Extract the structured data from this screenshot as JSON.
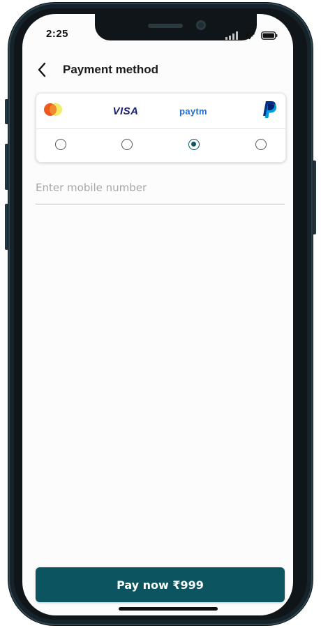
{
  "status_bar": {
    "time": "2:25"
  },
  "header": {
    "title": "Payment method",
    "back_icon": "chevron-left-icon"
  },
  "payment_methods": [
    {
      "name": "mastercard",
      "icon": "mastercard-logo-icon",
      "selected": false
    },
    {
      "name": "visa",
      "label": "VISA",
      "selected": false
    },
    {
      "name": "paytm",
      "label": "paytm",
      "selected": true
    },
    {
      "name": "paypal",
      "icon": "paypal-logo-icon",
      "selected": false
    }
  ],
  "mobile_input": {
    "placeholder": "Enter mobile number",
    "value": ""
  },
  "pay_button": {
    "label": "Pay now ₹999"
  },
  "colors": {
    "primary": "#0c5560",
    "visa_blue": "#1a1f71",
    "paytm_blue": "#1e6fd9",
    "paypal_dark": "#003087",
    "paypal_light": "#009cde",
    "mastercard_red": "#eb5b1d",
    "mastercard_yellow": "#f2ec6a"
  }
}
